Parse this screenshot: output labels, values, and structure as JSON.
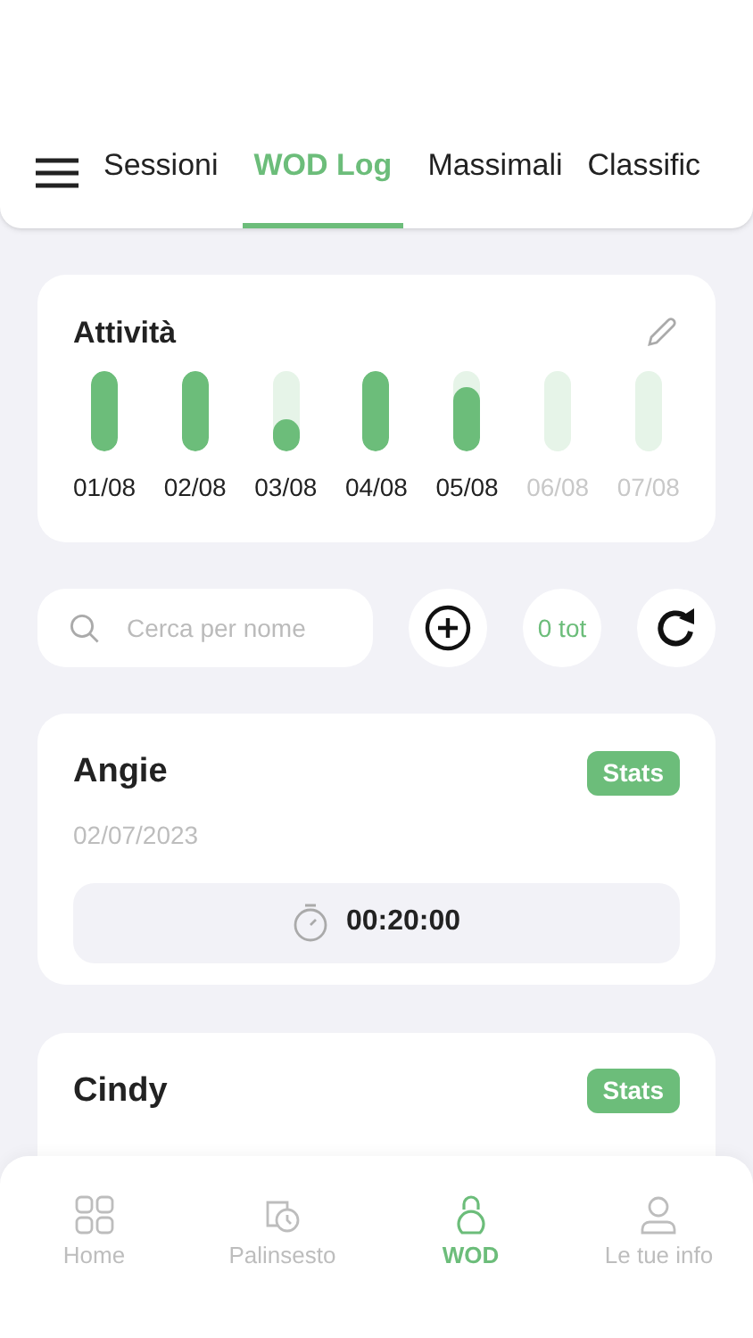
{
  "tabs": [
    {
      "label": "Sessioni",
      "selected": false
    },
    {
      "label": "WOD Log",
      "selected": true
    },
    {
      "label": "Massimali",
      "selected": false
    },
    {
      "label": "Classific",
      "selected": false
    }
  ],
  "activity": {
    "title": "Attività",
    "days": [
      {
        "label": "01/08",
        "level": 1,
        "future": false
      },
      {
        "label": "02/08",
        "level": 1,
        "future": false
      },
      {
        "label": "03/08",
        "level": 0.4,
        "future": false
      },
      {
        "label": "04/08",
        "level": 1,
        "future": false
      },
      {
        "label": "05/08",
        "level": 0.8,
        "future": false
      },
      {
        "label": "06/08",
        "level": 0,
        "future": true
      },
      {
        "label": "07/08",
        "level": 0,
        "future": true
      }
    ]
  },
  "search": {
    "placeholder": "Cerca per nome"
  },
  "total": "0 tot",
  "wods": [
    {
      "name": "Angie",
      "date": "02/07/2023",
      "badge": "Stats",
      "time": "00:20:00"
    },
    {
      "name": "Cindy",
      "badge": "Stats"
    }
  ],
  "bottom_nav": [
    {
      "label": "Home",
      "kind": "grid",
      "selected": false
    },
    {
      "label": "Palinsesto",
      "kind": "history",
      "selected": false
    },
    {
      "label": "WOD",
      "kind": "kettlebell",
      "selected": true
    },
    {
      "label": "Le tue info",
      "kind": "person",
      "selected": false
    }
  ]
}
